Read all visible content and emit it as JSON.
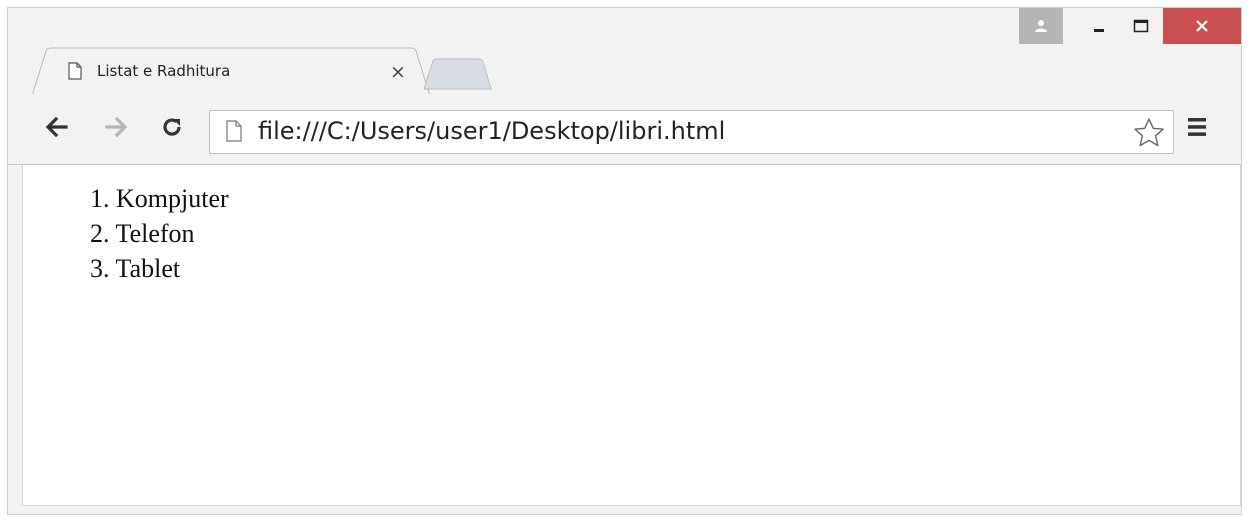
{
  "browser": {
    "tab": {
      "title": "Listat e Radhitura",
      "favicon": "page-icon",
      "close_symbol": "×"
    },
    "window_controls": {
      "user_icon": "user-icon",
      "minimize_icon": "minimize-icon",
      "maximize_icon": "maximize-icon",
      "close_icon": "close-icon",
      "close_color": "#c9504f"
    },
    "toolbar": {
      "back_icon": "back-arrow-icon",
      "forward_icon": "forward-arrow-icon",
      "reload_icon": "reload-icon",
      "url": "file:///C:/Users/user1/Desktop/libri.html",
      "star_icon": "bookmark-star-icon",
      "menu_icon": "hamburger-menu-icon"
    }
  },
  "page": {
    "ordered_list": [
      {
        "number": "1.",
        "text": "Kompjuter"
      },
      {
        "number": "2.",
        "text": "Telefon"
      },
      {
        "number": "3.",
        "text": "Tablet"
      }
    ]
  }
}
